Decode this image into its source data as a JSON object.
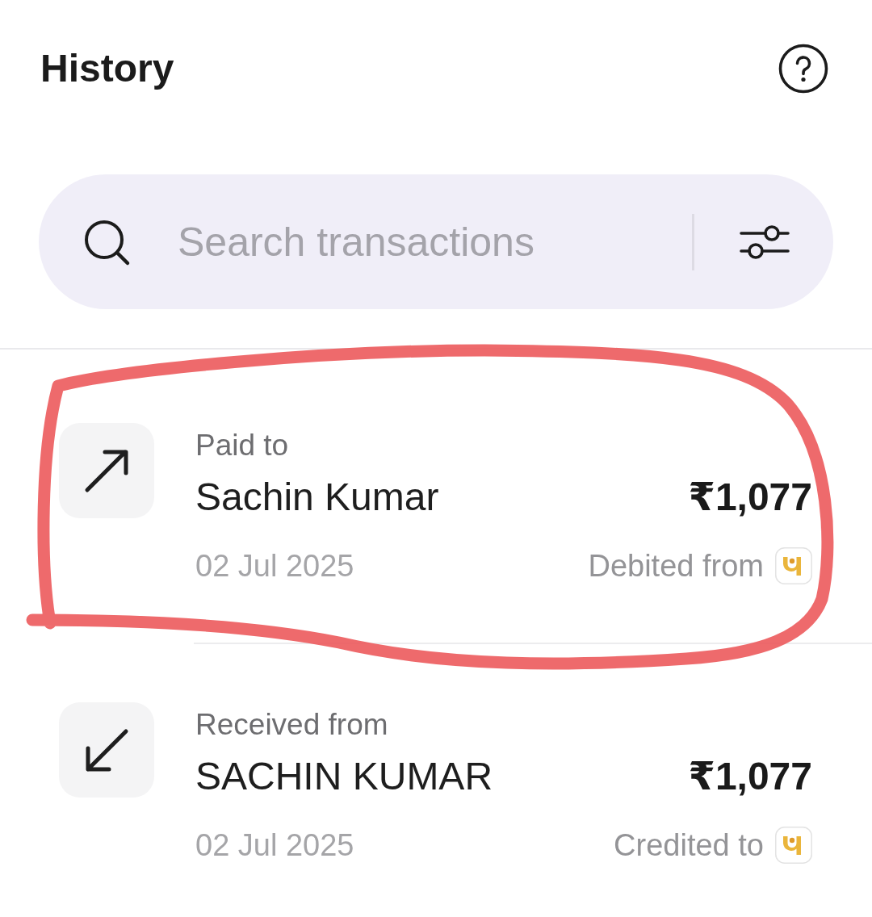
{
  "header": {
    "title": "History"
  },
  "search": {
    "placeholder": "Search transactions"
  },
  "transactions": [
    {
      "kind": "sent",
      "label": "Paid to",
      "name": "Sachin Kumar",
      "amount": "₹1,077",
      "date": "02 Jul 2025",
      "account_label": "Debited from",
      "circled": true
    },
    {
      "kind": "received",
      "label": "Received from",
      "name": "SACHIN KUMAR",
      "amount": "₹1,077",
      "date": "02 Jul 2025",
      "account_label": "Credited to",
      "circled": false
    }
  ]
}
